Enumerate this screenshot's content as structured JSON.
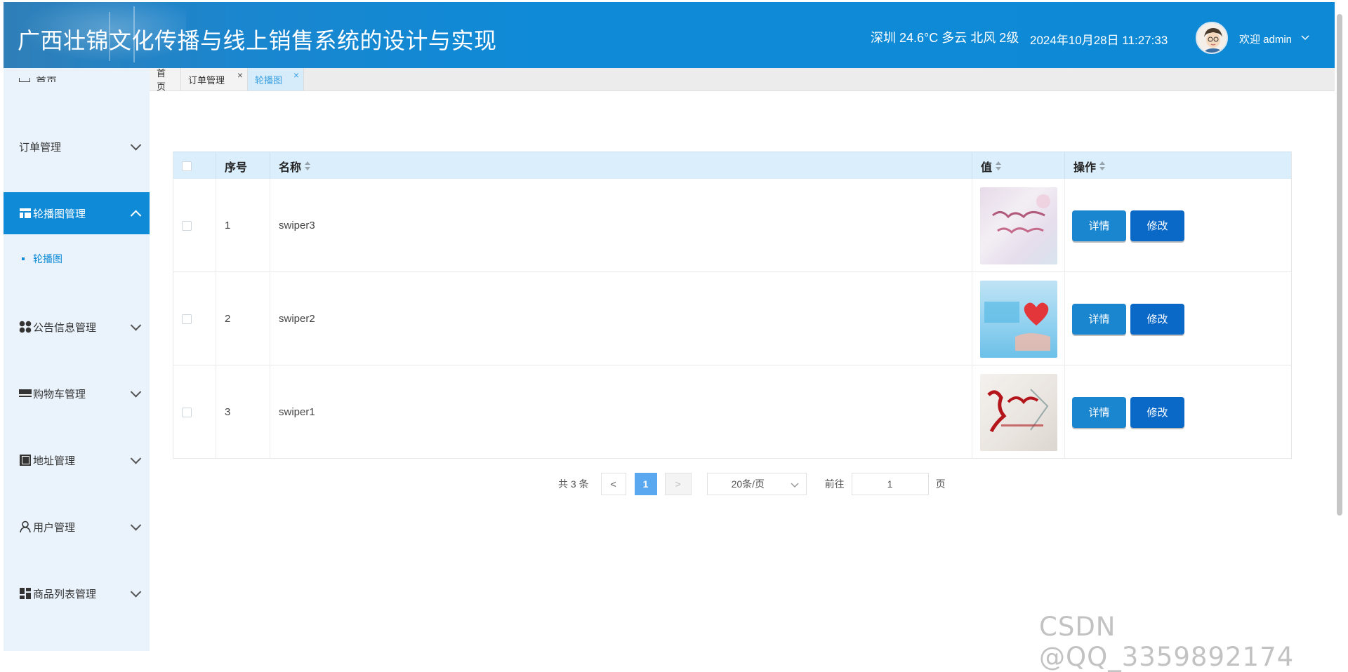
{
  "header": {
    "title": "广西壮锦文化传播与线上销售系统的设计与实现",
    "weather": "深圳 24.6°C 多云 北风 2级",
    "datetime": "2024年10月28日 11:27:33",
    "welcome": "欢迎 admin",
    "user_menu_icon": "chevron-down-icon"
  },
  "sidebar": {
    "home_partial": "首页",
    "items": [
      {
        "label": "订单管理",
        "icon": "none"
      },
      {
        "label": "轮播图管理",
        "icon": "layout-icon",
        "active": true,
        "sub": [
          "轮播图"
        ]
      },
      {
        "label": "公告信息管理",
        "icon": "grid-dots-icon"
      },
      {
        "label": "购物车管理",
        "icon": "card-icon"
      },
      {
        "label": "地址管理",
        "icon": "book-icon"
      },
      {
        "label": "用户管理",
        "icon": "user-icon"
      },
      {
        "label": "商品列表管理",
        "icon": "dashboard-icon"
      }
    ]
  },
  "tabs": [
    {
      "label": "首页",
      "closable": false
    },
    {
      "label": "订单管理",
      "closable": true
    },
    {
      "label": "轮播图",
      "closable": true,
      "active": true
    }
  ],
  "table": {
    "columns": [
      "序号",
      "名称",
      "值",
      "操作"
    ],
    "rows": [
      {
        "index": "1",
        "name": "swiper3",
        "image": "banner-pink-calligraphy"
      },
      {
        "index": "2",
        "name": "swiper2",
        "image": "banner-blue-heart"
      },
      {
        "index": "3",
        "name": "swiper1",
        "image": "banner-red-calligraphy"
      }
    ],
    "detail_label": "详情",
    "edit_label": "修改"
  },
  "pagination": {
    "total_text": "共 3 条",
    "prev": "<",
    "current": "1",
    "next": ">",
    "page_size": "20条/页",
    "goto_label": "前往",
    "goto_value": "1",
    "page_suffix": "页"
  },
  "watermark": "CSDN @QQ_3359892174",
  "colors": {
    "primary": "#0f8ad6",
    "header": "#0d89d5",
    "sidebar_bg": "#eaf3fc",
    "thead_bg": "#dbeefb"
  }
}
